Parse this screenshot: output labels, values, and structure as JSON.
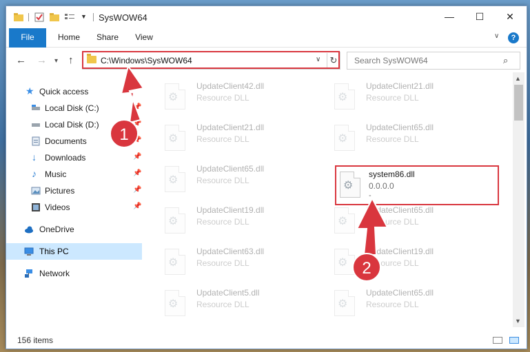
{
  "window": {
    "title": "SysWOW64",
    "min_icon": "minimize-icon",
    "max_icon": "maximize-icon",
    "close_icon": "close-icon"
  },
  "quick_access_toolbar": [
    "folder-icon",
    "properties-icon",
    "new-folder-icon",
    "list-icon",
    "chevron-down-icon"
  ],
  "ribbon": {
    "tabs": [
      {
        "label": "File",
        "active": true
      },
      {
        "label": "Home"
      },
      {
        "label": "Share"
      },
      {
        "label": "View"
      }
    ],
    "help": "?"
  },
  "navigation": {
    "address": "C:\\Windows\\SysWOW64",
    "search_placeholder": "Search SysWOW64"
  },
  "nav_pane": {
    "items": [
      {
        "label": "Quick access",
        "icon": "star-icon"
      },
      {
        "label": "Local Disk (C:)",
        "icon": "drive-icon",
        "pinned": true
      },
      {
        "label": "Local Disk (D:)",
        "icon": "drive-icon",
        "pinned": true
      },
      {
        "label": "Documents",
        "icon": "documents-icon",
        "pinned": true
      },
      {
        "label": "Downloads",
        "icon": "download-icon",
        "pinned": true
      },
      {
        "label": "Music",
        "icon": "music-icon",
        "pinned": true
      },
      {
        "label": "Pictures",
        "icon": "pictures-icon",
        "pinned": true
      },
      {
        "label": "Videos",
        "icon": "videos-icon",
        "pinned": true
      },
      {
        "label": "OneDrive",
        "icon": "cloud-icon"
      },
      {
        "label": "This PC",
        "icon": "computer-icon",
        "selected": true
      },
      {
        "label": "Network",
        "icon": "network-icon"
      }
    ]
  },
  "files": {
    "left_column": [
      {
        "name": "UpdateClient42.dll",
        "type": "Resource DLL"
      },
      {
        "name": "UpdateClient21.dll",
        "type": "Resource DLL"
      },
      {
        "name": "UpdateClient65.dll",
        "type": "Resource DLL"
      },
      {
        "name": "UpdateClient19.dll",
        "type": "Resource DLL"
      },
      {
        "name": "UpdateClient63.dll",
        "type": "Resource DLL"
      },
      {
        "name": "UpdateClient5.dll",
        "type": "Resource DLL"
      }
    ],
    "right_column": [
      {
        "name": "UpdateClient21.dll",
        "type": "Resource DLL"
      },
      {
        "name": "UpdateClient65.dll",
        "type": "Resource DLL"
      },
      {
        "name": "system86.dll",
        "type": "0.0.0.0",
        "extra": "-",
        "highlighted": true
      },
      {
        "name": "UpdateClient65.dll",
        "type": "Resource DLL"
      },
      {
        "name": "UpdateClient19.dll",
        "type": "Resource DLL"
      },
      {
        "name": "UpdateClient65.dll",
        "type": "Resource DLL"
      }
    ]
  },
  "status_bar": {
    "item_count": "156 items"
  },
  "annotations": {
    "step1": "1",
    "step2": "2",
    "color": "#d9363e"
  }
}
